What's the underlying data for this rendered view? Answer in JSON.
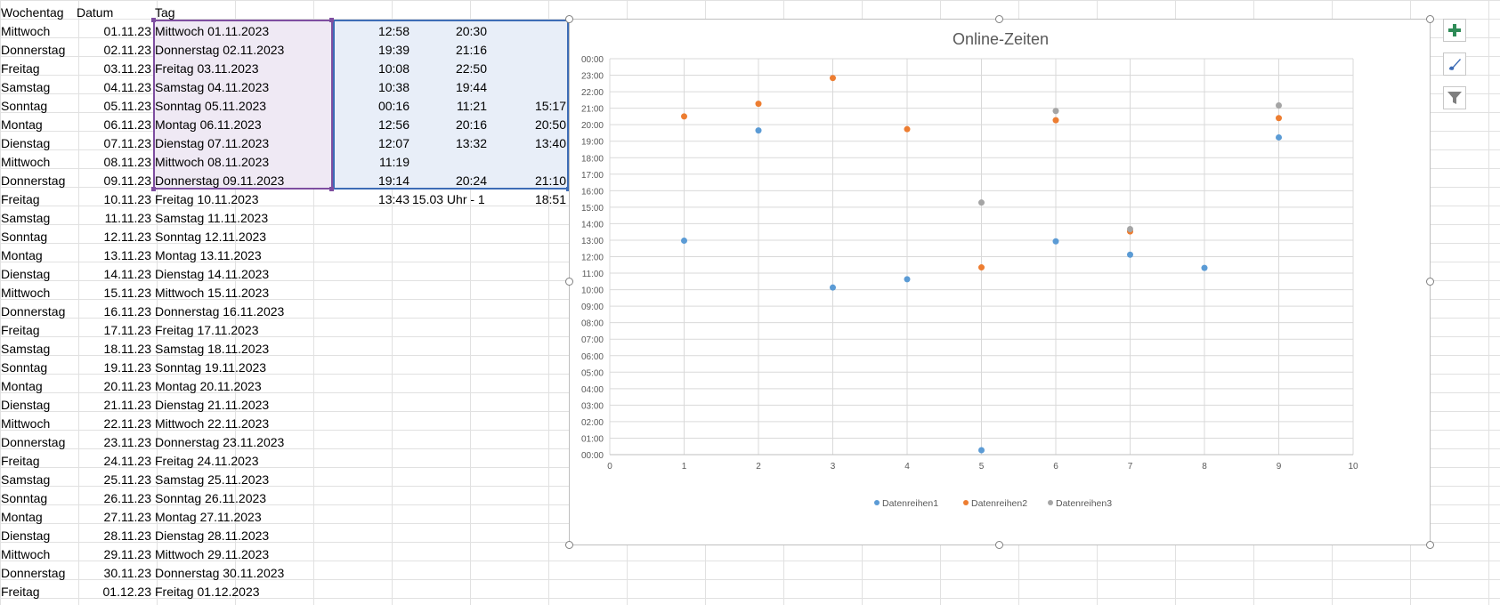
{
  "headers": [
    "Wochentag",
    "Datum",
    "Tag"
  ],
  "rows": [
    [
      "Mittwoch",
      "01.11.23",
      "Mittwoch 01.11.2023",
      "12:58",
      "20:30",
      ""
    ],
    [
      "Donnerstag",
      "02.11.23",
      "Donnerstag 02.11.2023",
      "19:39",
      "21:16",
      ""
    ],
    [
      "Freitag",
      "03.11.23",
      "Freitag 03.11.2023",
      "10:08",
      "22:50",
      ""
    ],
    [
      "Samstag",
      "04.11.23",
      "Samstag 04.11.2023",
      "10:38",
      "19:44",
      ""
    ],
    [
      "Sonntag",
      "05.11.23",
      "Sonntag 05.11.2023",
      "00:16",
      "11:21",
      "15:17"
    ],
    [
      "Montag",
      "06.11.23",
      "Montag 06.11.2023",
      "12:56",
      "20:16",
      "20:50"
    ],
    [
      "Dienstag",
      "07.11.23",
      "Dienstag 07.11.2023",
      "12:07",
      "13:32",
      "13:40"
    ],
    [
      "Mittwoch",
      "08.11.23",
      "Mittwoch 08.11.2023",
      "11:19",
      "",
      ""
    ],
    [
      "Donnerstag",
      "09.11.23",
      "Donnerstag 09.11.2023",
      "19:14",
      "20:24",
      "21:10"
    ],
    [
      "Freitag",
      "10.11.23",
      "Freitag 10.11.2023",
      "13:43",
      "15.03 Uhr - 1",
      "18:51"
    ],
    [
      "Samstag",
      "11.11.23",
      "Samstag 11.11.2023",
      "",
      "",
      ""
    ],
    [
      "Sonntag",
      "12.11.23",
      "Sonntag 12.11.2023",
      "",
      "",
      ""
    ],
    [
      "Montag",
      "13.11.23",
      "Montag 13.11.2023",
      "",
      "",
      ""
    ],
    [
      "Dienstag",
      "14.11.23",
      "Dienstag 14.11.2023",
      "",
      "",
      ""
    ],
    [
      "Mittwoch",
      "15.11.23",
      "Mittwoch 15.11.2023",
      "",
      "",
      ""
    ],
    [
      "Donnerstag",
      "16.11.23",
      "Donnerstag 16.11.2023",
      "",
      "",
      ""
    ],
    [
      "Freitag",
      "17.11.23",
      "Freitag 17.11.2023",
      "",
      "",
      ""
    ],
    [
      "Samstag",
      "18.11.23",
      "Samstag 18.11.2023",
      "",
      "",
      ""
    ],
    [
      "Sonntag",
      "19.11.23",
      "Sonntag 19.11.2023",
      "",
      "",
      ""
    ],
    [
      "Montag",
      "20.11.23",
      "Montag 20.11.2023",
      "",
      "",
      ""
    ],
    [
      "Dienstag",
      "21.11.23",
      "Dienstag 21.11.2023",
      "",
      "",
      ""
    ],
    [
      "Mittwoch",
      "22.11.23",
      "Mittwoch 22.11.2023",
      "",
      "",
      ""
    ],
    [
      "Donnerstag",
      "23.11.23",
      "Donnerstag 23.11.2023",
      "",
      "",
      ""
    ],
    [
      "Freitag",
      "24.11.23",
      "Freitag 24.11.2023",
      "",
      "",
      ""
    ],
    [
      "Samstag",
      "25.11.23",
      "Samstag 25.11.2023",
      "",
      "",
      ""
    ],
    [
      "Sonntag",
      "26.11.23",
      "Sonntag 26.11.2023",
      "",
      "",
      ""
    ],
    [
      "Montag",
      "27.11.23",
      "Montag 27.11.2023",
      "",
      "",
      ""
    ],
    [
      "Dienstag",
      "28.11.23",
      "Dienstag 28.11.2023",
      "",
      "",
      ""
    ],
    [
      "Mittwoch",
      "29.11.23",
      "Mittwoch 29.11.2023",
      "",
      "",
      ""
    ],
    [
      "Donnerstag",
      "30.11.23",
      "Donnerstag 30.11.2023",
      "",
      "",
      ""
    ],
    [
      "Freitag",
      "01.12.23",
      "Freitag 01.12.2023",
      "",
      "",
      ""
    ]
  ],
  "tools": {
    "add": "plus-icon",
    "style": "brush-icon",
    "filter": "filter-icon"
  },
  "colors": {
    "series1": "#5b9bd5",
    "series2": "#ed7d31",
    "series3": "#a5a5a5",
    "selection_purple": "#7e4ea0",
    "selection_blue": "#3d6cb6"
  },
  "chart_data": {
    "type": "scatter",
    "title": "Online-Zeiten",
    "xlim": [
      0,
      10
    ],
    "ylim": [
      0,
      24
    ],
    "xticks": [
      "0",
      "1",
      "2",
      "3",
      "4",
      "5",
      "6",
      "7",
      "8",
      "9",
      "10"
    ],
    "yticks": [
      "00:00",
      "01:00",
      "02:00",
      "03:00",
      "04:00",
      "05:00",
      "06:00",
      "07:00",
      "08:00",
      "09:00",
      "10:00",
      "11:00",
      "12:00",
      "13:00",
      "14:00",
      "15:00",
      "16:00",
      "17:00",
      "18:00",
      "19:00",
      "20:00",
      "21:00",
      "22:00",
      "23:00",
      "00:00"
    ],
    "grid": true,
    "legend_position": "bottom",
    "series": [
      {
        "name": "Datenreihen1",
        "color": "#5b9bd5",
        "points": [
          [
            1,
            12.97
          ],
          [
            2,
            19.65
          ],
          [
            3,
            10.13
          ],
          [
            4,
            10.63
          ],
          [
            5,
            0.27
          ],
          [
            6,
            12.93
          ],
          [
            7,
            12.12
          ],
          [
            8,
            11.32
          ],
          [
            9,
            19.23
          ]
        ]
      },
      {
        "name": "Datenreihen2",
        "color": "#ed7d31",
        "points": [
          [
            1,
            20.5
          ],
          [
            2,
            21.27
          ],
          [
            3,
            22.83
          ],
          [
            4,
            19.73
          ],
          [
            5,
            11.35
          ],
          [
            6,
            20.27
          ],
          [
            7,
            13.53
          ],
          [
            9,
            20.4
          ]
        ]
      },
      {
        "name": "Datenreihen3",
        "color": "#a5a5a5",
        "points": [
          [
            5,
            15.28
          ],
          [
            6,
            20.83
          ],
          [
            7,
            13.67
          ],
          [
            9,
            21.17
          ]
        ]
      }
    ]
  }
}
